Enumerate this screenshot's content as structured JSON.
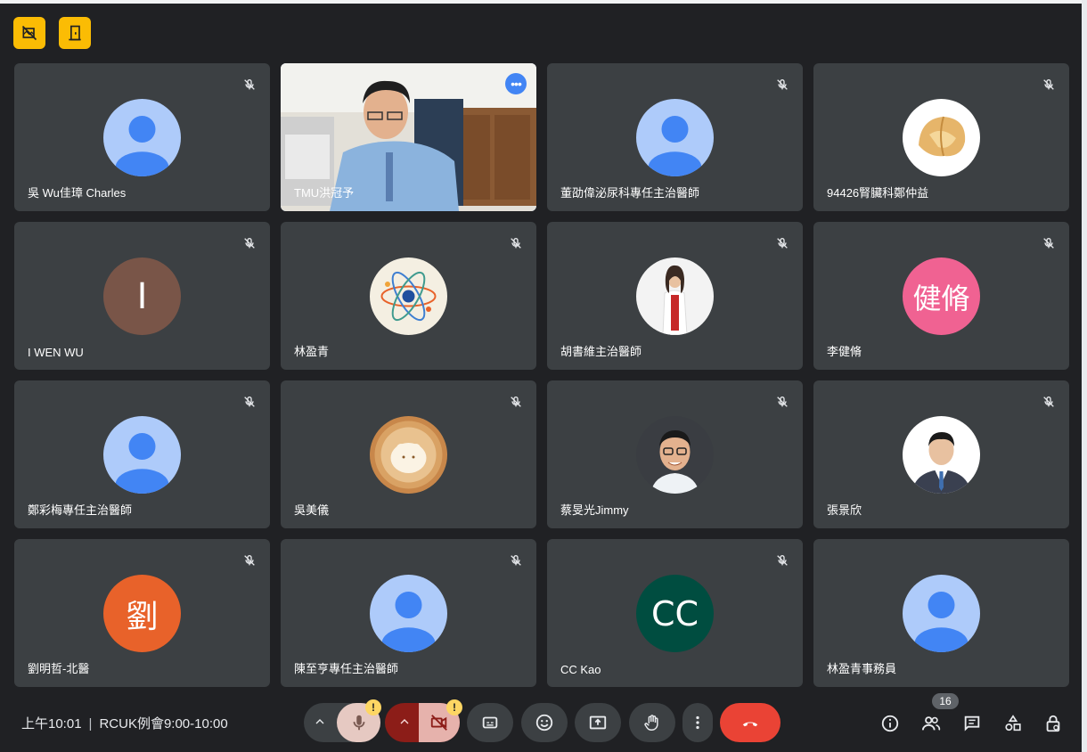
{
  "colors": {
    "background": "#202124",
    "tile": "#3c4043",
    "accent_yellow": "#fbbc04",
    "end_call": "#ea4335",
    "active_outline": "#8ab4f8"
  },
  "top_buttons": [
    {
      "icon": "no-hd-icon"
    },
    {
      "icon": "door-exit-icon"
    }
  ],
  "participants": [
    {
      "name": "吳 Wu佳璋 Charles",
      "avatar": "generic",
      "muted": true
    },
    {
      "name": "TMU洪冠予",
      "avatar": "video",
      "muted": false,
      "active": true
    },
    {
      "name": "董劭偉泌尿科專任主治醫師",
      "avatar": "generic",
      "muted": true
    },
    {
      "name": "94426腎臟科鄭仲益",
      "avatar": "fortune-cookie-photo",
      "muted": true
    },
    {
      "name": "I WEN WU",
      "avatar": "letter",
      "letter": "I",
      "color": "#795548",
      "muted": true
    },
    {
      "name": "林盈青",
      "avatar": "atom-image",
      "muted": true
    },
    {
      "name": "胡書維主治醫師",
      "avatar": "doctor-photo",
      "muted": true
    },
    {
      "name": "李健脩",
      "avatar": "letter",
      "letter": "健脩",
      "color": "#f06292",
      "muted": true
    },
    {
      "name": "鄭彩梅專任主治醫師",
      "avatar": "generic",
      "muted": true
    },
    {
      "name": "吳美儀",
      "avatar": "latte-art-photo",
      "muted": true
    },
    {
      "name": "蔡旻光Jimmy",
      "avatar": "man-glasses-photo",
      "muted": true
    },
    {
      "name": "張景欣",
      "avatar": "man-suit-photo",
      "muted": true
    },
    {
      "name": "劉明哲-北醫",
      "avatar": "letter",
      "letter": "劉",
      "color": "#e8622a",
      "muted": true
    },
    {
      "name": "陳至亨專任主治醫師",
      "avatar": "generic",
      "muted": true
    },
    {
      "name": "CC Kao",
      "avatar": "letter",
      "letter": "CC",
      "color": "#004d40",
      "muted": true
    },
    {
      "name": "林盈青事務員",
      "avatar": "generic",
      "muted": false
    }
  ],
  "bottom_bar": {
    "time": "上午10:01",
    "separator": "|",
    "meeting_title": "RCUK例會9:00-10:00",
    "mic_badge": "!",
    "cam_badge": "!",
    "people_count": "16"
  }
}
